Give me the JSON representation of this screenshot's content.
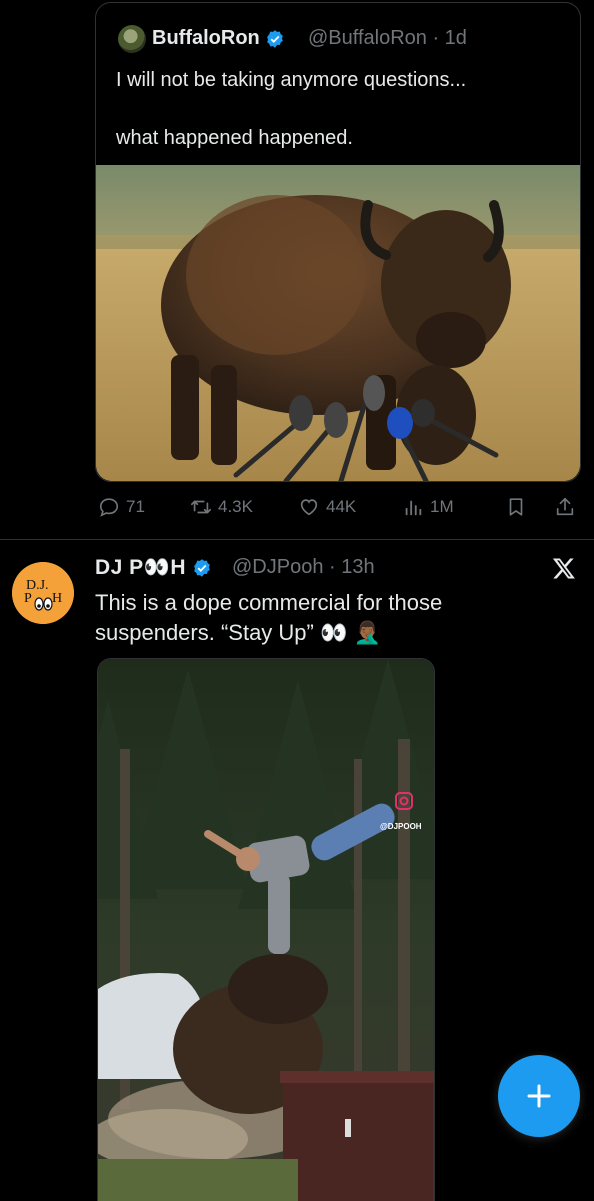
{
  "quote": {
    "display_name": "BuffaloRon",
    "handle_time": "@BuffaloRon · 1d",
    "text_line1": "I will not be taking anymore questions...",
    "text_line2": "what happened happened."
  },
  "actions": {
    "replies": "71",
    "reposts": "4.3K",
    "likes": "44K",
    "views": "1M"
  },
  "tweet2": {
    "display_name": "DJ P👀H",
    "handle_time": "@DJPooh · 13h",
    "text_line1": "This is a dope commercial for those",
    "text_line2": "suspenders. “Stay Up” 👀 🤦🏾‍♂️",
    "video_watermark": "@DJPOOH"
  },
  "icons": {
    "verified": "verified-badge-icon",
    "reply": "reply-icon",
    "repost": "repost-icon",
    "like": "heart-icon",
    "views": "views-icon",
    "bookmark": "bookmark-icon",
    "share": "share-icon",
    "close": "x-logo-icon",
    "compose": "plus-icon"
  },
  "colors": {
    "accent": "#1d9bf0",
    "muted": "#71767b",
    "text": "#e7e9ea",
    "background": "#000000"
  }
}
